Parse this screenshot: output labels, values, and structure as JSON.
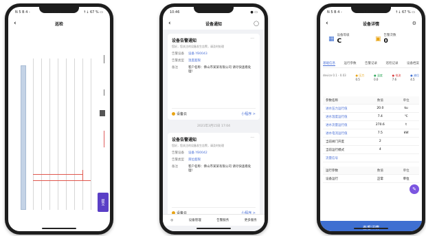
{
  "phone1": {
    "status_left": "N 5 B 4 -",
    "status_time": "10:11",
    "status_right": "↑↓ 67 % ▭",
    "title": "巡检",
    "side_label_1": "━━━━",
    "side_label_2": "━━━",
    "alert_text": "━━━━━━━━",
    "button_label": "提交"
  },
  "phone2": {
    "status_time": "10:46",
    "status_right": "● ▭",
    "title": "设备通知",
    "cards": [
      {
        "title": "设备告警通知",
        "desc": "您好，您关注的设备发生告警，请及时处理",
        "rows": [
          {
            "k": "告警设备",
            "v": "设备 YB0043"
          },
          {
            "k": "告警类型",
            "v": "温度超限"
          },
          {
            "k": "备注",
            "v": "客户名称：佛山市某某有限公司 请尽快查看处理！"
          }
        ],
        "foot_left": "设备云",
        "foot_right": "小程序 >"
      },
      {
        "title": "设备告警通知",
        "desc": "您好，您关注的设备发生告警，请及时处理",
        "rows": [
          {
            "k": "告警设备",
            "v": "设备 YB0042"
          },
          {
            "k": "告警类型",
            "v": "液位超限"
          },
          {
            "k": "备注",
            "v": "客户名称：佛山市某某有限公司 请尽快查看处理！"
          }
        ],
        "foot_left": "设备云",
        "foot_right": "小程序 >"
      }
    ],
    "timestamp": "2021年3月15日 17:04",
    "tab_items": [
      "设备管理",
      "告警服务",
      "更多服务"
    ]
  },
  "phone3": {
    "status_left": "N 5 B 4 -",
    "status_time": "10:11",
    "status_right": "↑↓ 67 % ▭",
    "title": "设备详情",
    "info_left_label": "设备等级",
    "info_left_value": "C",
    "info_right_label": "告警次数",
    "info_right_value": "0",
    "tabs": [
      "基础信息",
      "运行参数",
      "告警记录",
      "巡检记录",
      "设备档案"
    ],
    "legend_left": "device 0.1 - 0.03",
    "legend_items": [
      "● 压力",
      "● 温度",
      "● 电流",
      "● 液位"
    ],
    "legend_values": [
      "0.5",
      "0.0",
      "7.6",
      "4.5"
    ],
    "table_head": [
      "参数名称",
      "数值",
      "单位"
    ],
    "rows": [
      {
        "name": "进水压力运行值",
        "v1": "20.0",
        "v2": "ku"
      },
      {
        "name": "进水温度运行值",
        "v1": "7.4",
        "v2": "℃"
      },
      {
        "name": "进水流量运行值",
        "v1": "270.6",
        "v2": "t"
      },
      {
        "name": "进水电流运行值",
        "v1": "7.5",
        "v2": "kW"
      },
      {
        "name": "当前阀门开度",
        "v1": "2",
        "v2": ""
      },
      {
        "name": "当前运行模式",
        "v1": "4",
        "v2": ""
      },
      {
        "name": "流量信号",
        "v1": "",
        "v2": ""
      }
    ],
    "footer_head": [
      "运行参数",
      "数值",
      "单位"
    ],
    "footer_row": [
      "设备运行",
      "正常",
      "单位"
    ],
    "bottom_button": "查看详情"
  }
}
